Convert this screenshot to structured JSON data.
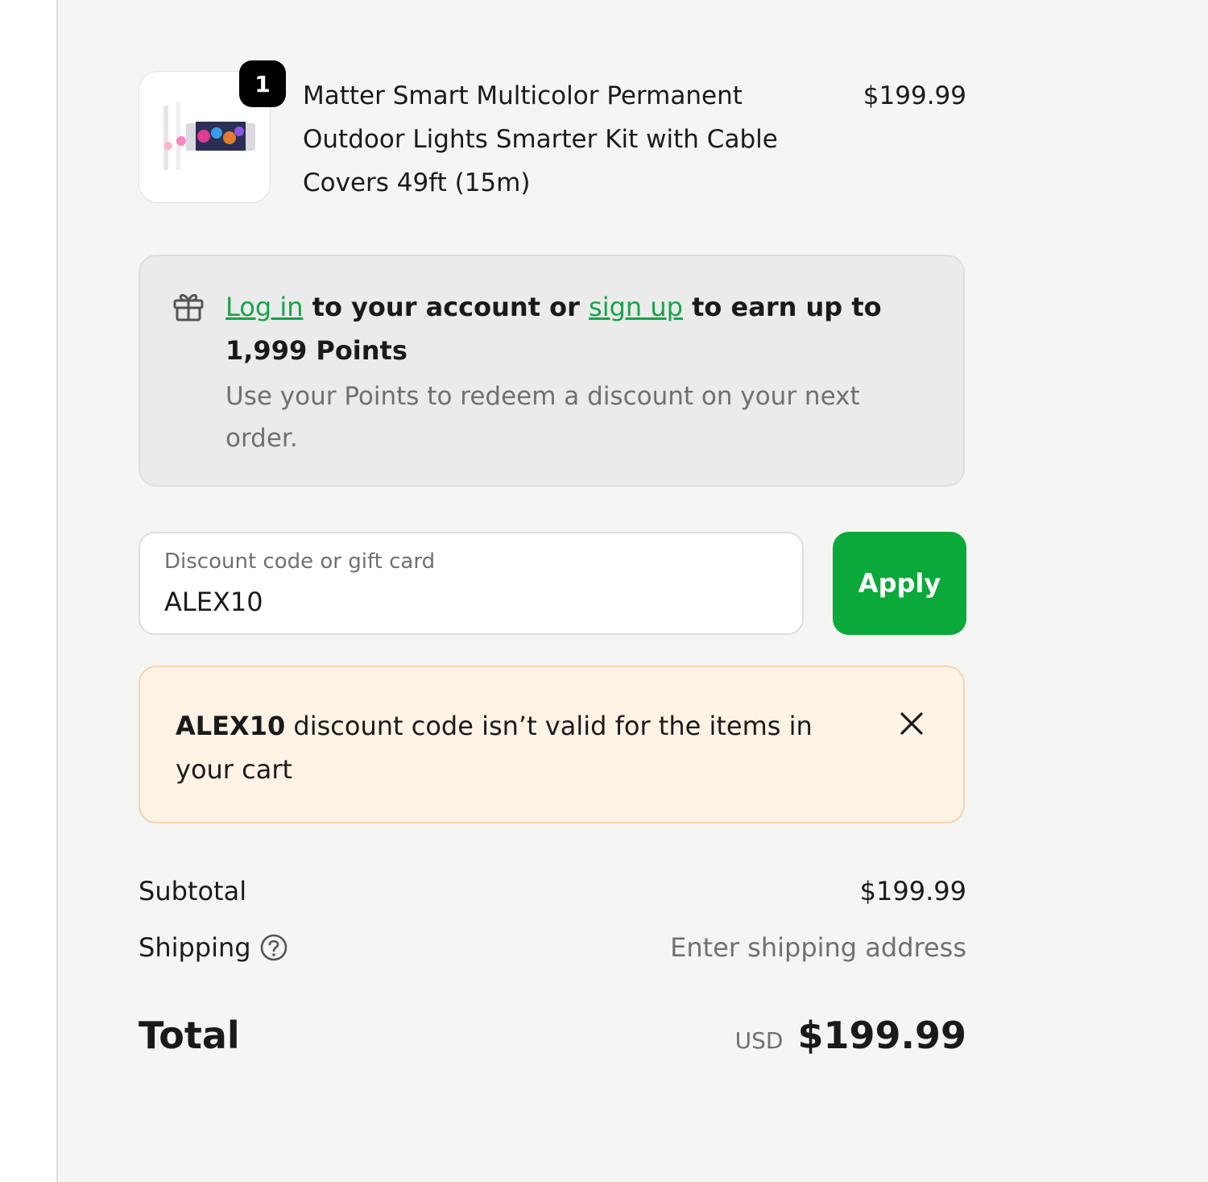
{
  "product": {
    "quantity": "1",
    "title": "Matter Smart Multicolor Permanent Outdoor Lights Smarter Kit with Cable Covers 49ft (15m)",
    "price": "$199.99",
    "image_icon": "product-thumbnail"
  },
  "rewards": {
    "icon": "gift-icon",
    "login_link": "Log in",
    "text_middle": " to your account or ",
    "signup_link": "sign up",
    "text_end": " to earn up to 1,999 Points",
    "subtext": "Use your Points to redeem a discount on your next order.",
    "link_color": "#16a34a"
  },
  "discount": {
    "label": "Discount code or gift card",
    "value": "ALEX10",
    "apply_label": "Apply",
    "apply_color": "#0aa93a"
  },
  "warning": {
    "code": "ALEX10",
    "message": " discount code isn’t valid for the items in your cart",
    "close_icon": "close-icon",
    "background": "#fff3e6"
  },
  "summary": {
    "subtotal_label": "Subtotal",
    "subtotal_value": "$199.99",
    "shipping_label": "Shipping",
    "shipping_value": "Enter shipping address",
    "help_icon": "help-icon",
    "total_label": "Total",
    "currency": "USD",
    "total_value": "$199.99"
  }
}
